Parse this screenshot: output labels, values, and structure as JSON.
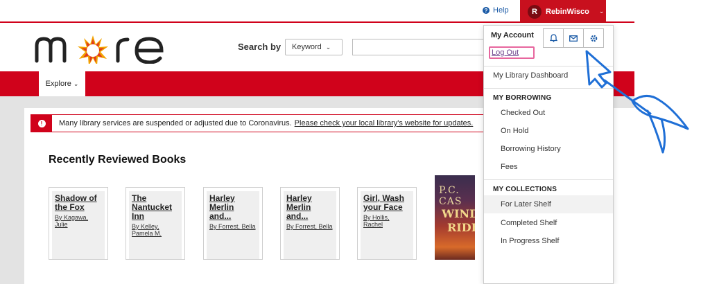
{
  "topbar": {
    "help_label": "Help",
    "help_icon": "question-circle-icon",
    "user_initial": "R",
    "user_name": "RebinWisco"
  },
  "header": {
    "logo_text": "more",
    "search_label": "Search by",
    "search_type": "Keyword",
    "search_value": ""
  },
  "nav": {
    "explore_label": "Explore"
  },
  "alert": {
    "message": "Many library services are suspended or adjusted due to Coronavirus.",
    "link_text": "Please check your local library's website for updates."
  },
  "section_title": "Recently Reviewed Books",
  "books": [
    {
      "title": "Shadow of the Fox",
      "author": "By Kagawa, Julie"
    },
    {
      "title": "The Nantucket Inn",
      "author": "By Kelley, Pamela M."
    },
    {
      "title": "Harley Merlin and...",
      "author": "By Forrest, Bella"
    },
    {
      "title": "Harley Merlin and...",
      "author": "By Forrest, Bella"
    },
    {
      "title": "Girl, Wash your Face",
      "author": "By Hollis, Rachel"
    }
  ],
  "cover": {
    "line1": "P.C. CAS",
    "line2": "WIND",
    "line3": "RIDE"
  },
  "account_menu": {
    "header": "My Account",
    "logout_label": "Log Out",
    "dashboard_label": "My Library Dashboard",
    "borrowing_heading": "MY BORROWING",
    "borrowing_items": [
      "Checked Out",
      "On Hold",
      "Borrowing History",
      "Fees"
    ],
    "collections_heading": "MY COLLECTIONS",
    "collection_items": [
      "For Later Shelf",
      "Completed Shelf",
      "In Progress Shelf"
    ],
    "icons": [
      "bell-icon",
      "envelope-icon",
      "gear-icon"
    ]
  },
  "colors": {
    "brand_red": "#d0021b",
    "link_blue": "#1a5aa6",
    "highlight_pink": "#e7669e",
    "annotation_blue": "#1f6fd6"
  }
}
